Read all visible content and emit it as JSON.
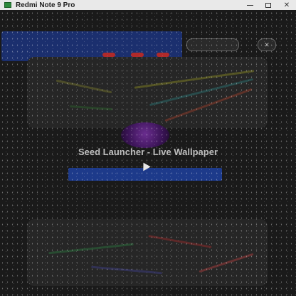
{
  "window": {
    "title": "Redmi Note 9 Pro",
    "icon": "phone-mirror-app-icon",
    "buttons": [
      "minimize",
      "maximize",
      "close"
    ]
  },
  "ad": {
    "headline": "",
    "subline": "",
    "accent_color": "#1b2f6e"
  },
  "header": {
    "pill_label": "",
    "close_label": ""
  },
  "app": {
    "title": "Seed Launcher - Live Wallpaper",
    "install_label": ""
  },
  "colors": {
    "button_blue": "#1d3a8a",
    "logo_purple": "#6a2d8f"
  }
}
